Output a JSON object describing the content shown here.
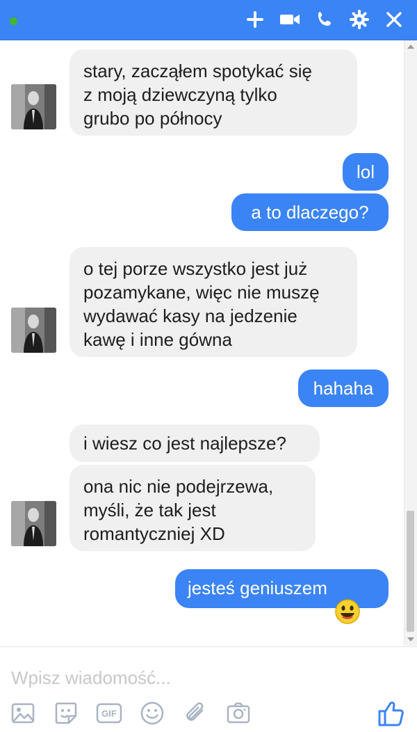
{
  "colors": {
    "brand": "#3b84f5",
    "incoming_bubble": "#f1f0f0",
    "online": "#42b72a"
  },
  "header": {
    "icons": [
      "add-icon",
      "video-call-icon",
      "phone-icon",
      "settings-icon",
      "close-icon"
    ]
  },
  "messages": {
    "m1": "stary, zacząłem spotykać się\nz moją dziewczyną tylko\ngrubo po północy",
    "m2": "lol",
    "m3": "a to dlaczego?",
    "m4": "o tej porze wszystko jest już\npozamykane, więc nie muszę\nwydawać kasy na jedzenie\nkawę i inne gówna",
    "m5": "hahaha",
    "m6": "i wiesz co jest najlepsze?",
    "m7": "ona nic nie podejrzewa,\nmyśli, że tak jest\nromantyczniej XD",
    "m8": "jesteś geniuszem"
  },
  "composer": {
    "placeholder": "Wpisz wiadomość..."
  },
  "toolbar": {
    "icons": [
      "image-icon",
      "sticker-icon",
      "gif-icon",
      "emoji-icon",
      "attachment-icon",
      "camera-icon",
      "like-icon"
    ],
    "gif_label": "GIF"
  }
}
